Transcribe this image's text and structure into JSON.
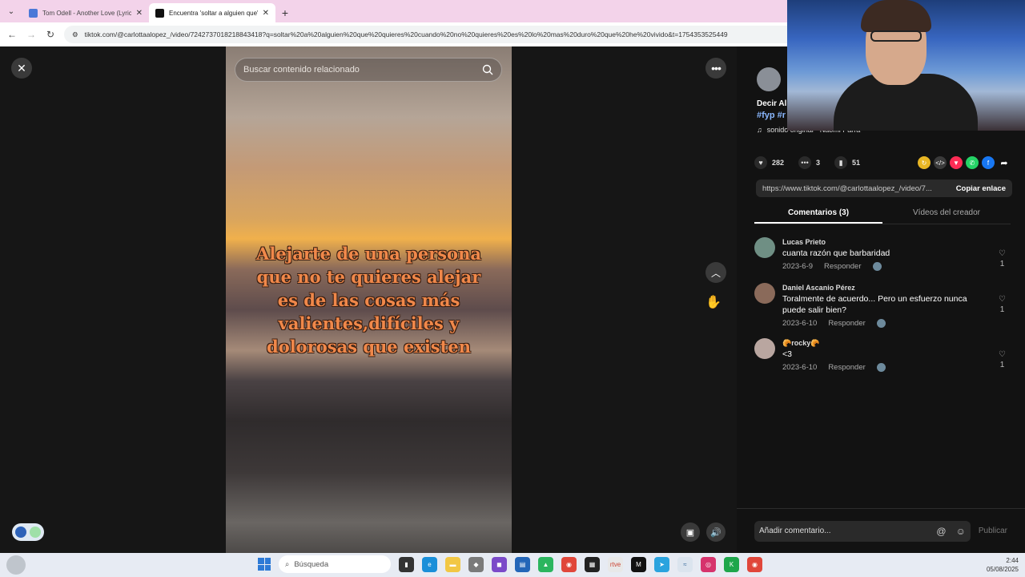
{
  "browser": {
    "tabs": [
      {
        "title": "Tom Odell - Another Love (Lyrics)",
        "active": false,
        "favicon_color": "#4b78d8"
      },
      {
        "title": "Encuentra 'soltar a alguien que'",
        "active": true,
        "favicon_color": "#111111"
      }
    ],
    "url": "tiktok.com/@carlottaalopez_/video/7242737018218843418?q=soltar%20a%20alguien%20que%20quieres%20cuando%20no%20quieres%20es%20lo%20mas%20duro%20que%20he%20vivido&t=1754353525449"
  },
  "video": {
    "search_placeholder": "Buscar contenido relacionado",
    "overlay_text": "Alejarte de una persona\nque no te quieres alejar\nes de las cosas más\nvalientes,difíciles y\ndolorosas que existen"
  },
  "panel": {
    "description": "Decir Al",
    "hashtags": "#fyp #r",
    "sound": "sonido original - Naomi Parra",
    "likes": "282",
    "comments_count": "3",
    "saves": "51",
    "share_link": "https://www.tiktok.com/@carlottaalopez_/video/7...",
    "copy_label": "Copiar enlace",
    "tab_comments": "Comentarios (3)",
    "tab_creator": "Vídeos del creador",
    "comments": [
      {
        "name": "Lucas Prieto",
        "text": "cuanta razón que barbaridad",
        "date": "2023-6-9",
        "reply": "Responder",
        "likes": "1",
        "avatar_color": "#6f8f84"
      },
      {
        "name": "Daniel Ascanio Pérez",
        "text": "Toralmente de acuerdo... Pero un esfuerzo nunca puede salir bien?",
        "date": "2023-6-10",
        "reply": "Responder",
        "likes": "1",
        "avatar_color": "#8a6a5a"
      },
      {
        "name": "🥐rocky🥐",
        "text": "<3",
        "date": "2023-6-10",
        "reply": "Responder",
        "likes": "1",
        "avatar_color": "#b9a6a0"
      }
    ],
    "comment_placeholder": "Añadir comentario...",
    "publish_label": "Publicar"
  },
  "taskbar": {
    "search_label": "Búsqueda",
    "time": "2:44",
    "date": "05/08/2025"
  }
}
